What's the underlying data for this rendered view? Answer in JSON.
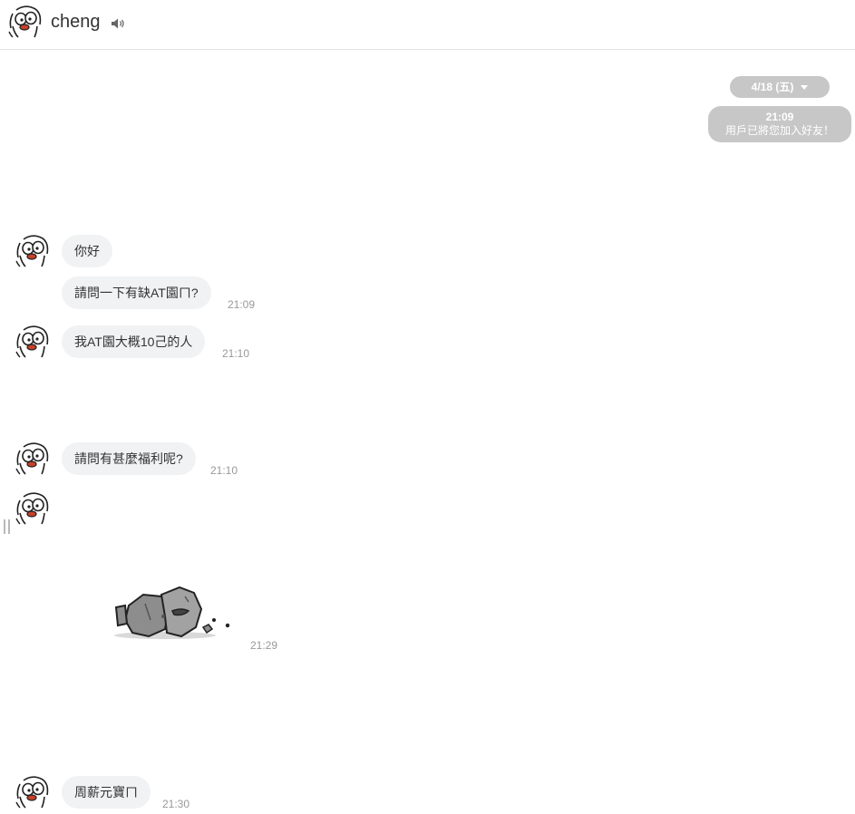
{
  "header": {
    "contact_name": "cheng",
    "speaker_icon": "speaker-icon"
  },
  "date_divider": {
    "label": "4/18 (五)"
  },
  "system_message": {
    "time": "21:09",
    "text": "用戶已將您加入好友！"
  },
  "messages": [
    {
      "text": "你好",
      "time": ""
    },
    {
      "text": "請問一下有缺AT園ㄇ?",
      "time": "21:09"
    },
    {
      "text": "我AT園大概10己的人",
      "time": "21:10"
    },
    {
      "text": "請問有甚麼福利呢?",
      "time": "21:10"
    },
    {
      "sticker": "rock-sticker",
      "time": "21:29"
    },
    {
      "text": "周薪元寶ㄇ",
      "time": "21:30"
    }
  ],
  "colors": {
    "bubble_bg": "#f1f2f4",
    "system_bg": "#c7c7c7",
    "time_text": "#999999"
  }
}
